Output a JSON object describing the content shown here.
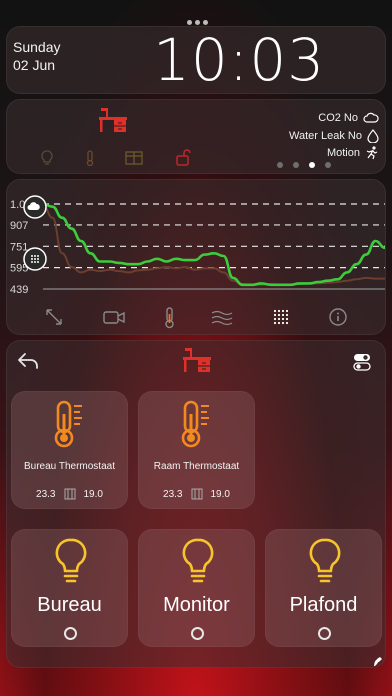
{
  "clock": {
    "day": "Sunday",
    "date": "02 Jun",
    "time": "10:03"
  },
  "status": {
    "items": [
      {
        "label": "CO2 No",
        "icon": "cloud-icon"
      },
      {
        "label": "Water Leak No",
        "icon": "water-drop-icon"
      },
      {
        "label": "Motion",
        "icon": "running-person-icon"
      }
    ],
    "page_indicator": {
      "count": 4,
      "active": 3
    }
  },
  "chart_data": {
    "type": "line",
    "y_ticks": [
      "1.06",
      "907",
      "751",
      "595",
      "439"
    ],
    "series": [
      {
        "values": [
          1060,
          1040,
          960,
          880,
          790,
          700,
          640,
          640,
          630,
          620,
          620,
          640,
          660,
          640,
          660,
          650,
          650,
          690,
          700,
          680,
          520,
          470,
          470,
          480,
          470,
          470,
          470,
          480,
          480,
          490,
          500,
          510,
          560,
          620,
          690,
          790,
          740
        ]
      },
      {
        "values": [
          1050,
          960,
          700,
          600,
          560,
          580,
          570,
          580,
          570,
          560,
          575,
          580,
          590,
          600,
          590,
          600,
          580,
          590,
          590,
          560,
          500,
          475,
          470,
          470,
          475,
          470,
          470,
          475,
          480,
          480,
          485,
          490,
          500,
          510,
          520,
          515,
          515
        ]
      }
    ],
    "grid": true
  },
  "chart_toolbar": [
    "expand-icon",
    "camera-icon",
    "thermometer-icon",
    "wind-icon",
    "dots-grid-icon",
    "info-icon"
  ],
  "controls": {
    "thermostats": [
      {
        "name": "Bureau Thermostaat",
        "current": "23.3",
        "target": "19.0"
      },
      {
        "name": "Raam Thermostaat",
        "current": "23.3",
        "target": "19.0"
      }
    ],
    "lights": [
      {
        "name": "Bureau"
      },
      {
        "name": "Monitor"
      },
      {
        "name": "Plafond"
      }
    ]
  },
  "colors": {
    "accent_orange": "#f28a1e",
    "light_yellow": "#f7c52b",
    "line_green": "#3ccc3c",
    "icon_red": "#e0302a"
  }
}
